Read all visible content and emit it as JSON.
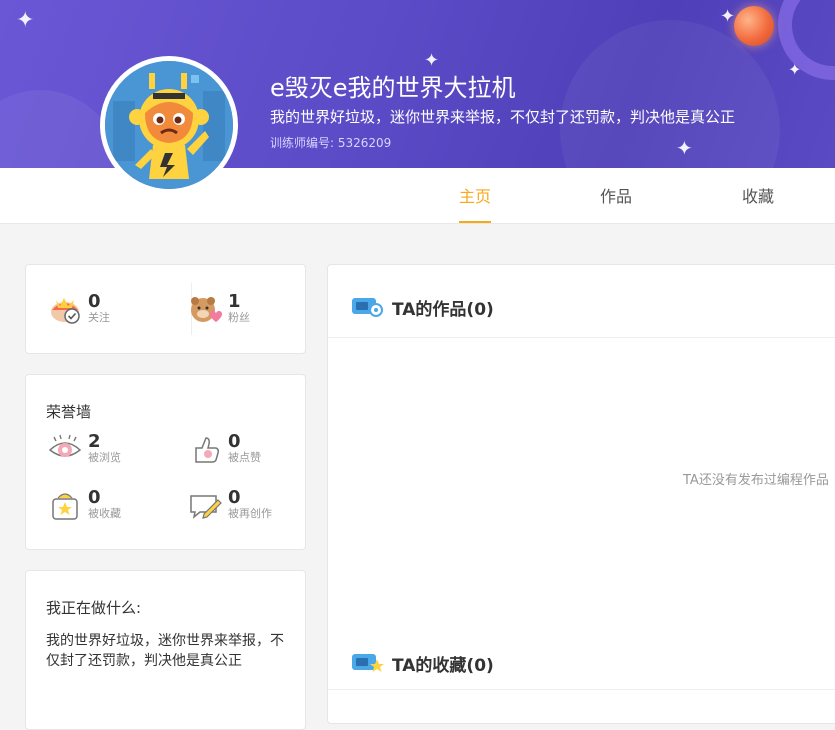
{
  "profile": {
    "name": "e毁灭e我的世界大拉机",
    "signature": "我的世界好垃圾，迷你世界来举报，不仅封了还罚款，判决他是真公正",
    "trainer_id": "训练师编号: 5326209"
  },
  "tabs": [
    {
      "label": "主页",
      "active": true
    },
    {
      "label": "作品",
      "active": false
    },
    {
      "label": "收藏",
      "active": false
    }
  ],
  "follow_stats": [
    {
      "value": "0",
      "label": "关注",
      "icon": "follow-icon"
    },
    {
      "value": "1",
      "label": "粉丝",
      "icon": "fans-icon"
    }
  ],
  "honor": {
    "title": "荣誉墙",
    "items": [
      {
        "value": "2",
        "label": "被浏览",
        "icon": "eye-icon"
      },
      {
        "value": "0",
        "label": "被点赞",
        "icon": "thumbs-up-icon"
      },
      {
        "value": "0",
        "label": "被收藏",
        "icon": "favorite-box-icon"
      },
      {
        "value": "0",
        "label": "被再创作",
        "icon": "recreate-icon"
      }
    ]
  },
  "doing": {
    "title": "我正在做什么:",
    "text": "我的世界好垃圾，迷你世界来举报，不仅封了还罚款，判决他是真公正"
  },
  "works_panel": {
    "title": "TA的作品(0)",
    "empty": "TA还没有发布过编程作品"
  },
  "collection_panel": {
    "title": "TA的收藏(0)"
  },
  "colors": {
    "accent": "#f7a81b",
    "banner": "#5b4bc6",
    "background": "#f4f4f4"
  }
}
